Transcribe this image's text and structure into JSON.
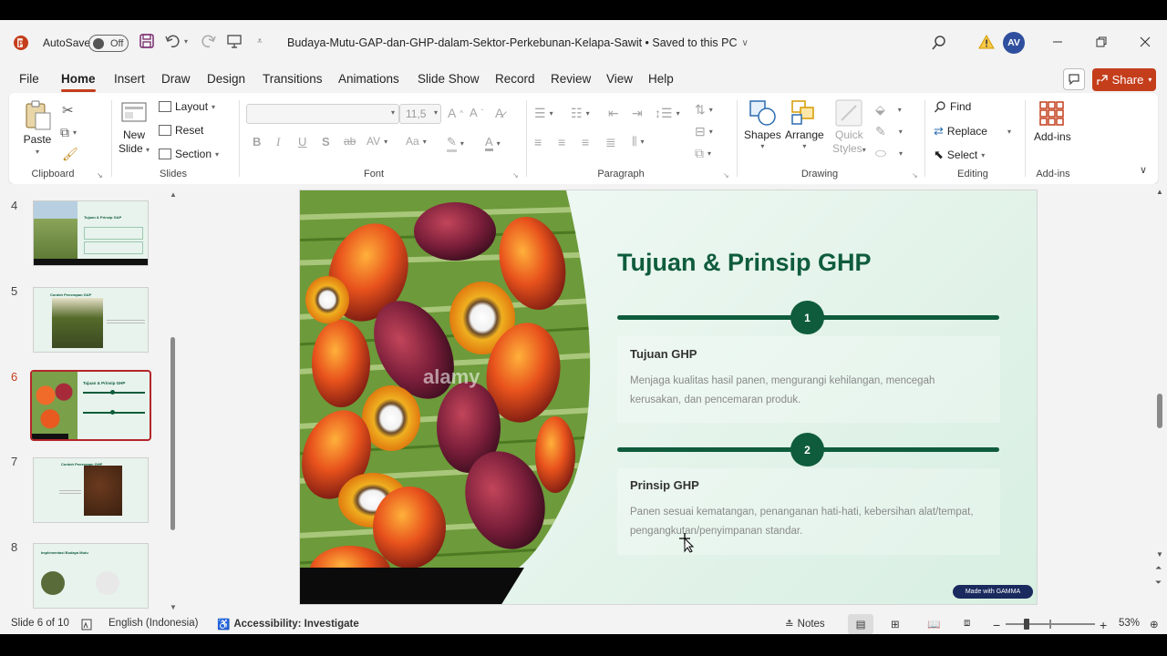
{
  "titlebar": {
    "autosave_label": "AutoSave",
    "toggle_state": "Off",
    "doc_title": "Budaya-Mutu-GAP-dan-GHP-dalam-Sektor-Perkebunan-Kelapa-Sawit • Saved to this PC",
    "avatar_initials": "AV"
  },
  "menu": {
    "items": [
      "File",
      "Home",
      "Insert",
      "Draw",
      "Design",
      "Transitions",
      "Animations",
      "Slide Show",
      "Record",
      "Review",
      "View",
      "Help"
    ],
    "active": "Home",
    "share_label": "Share"
  },
  "ribbon": {
    "clipboard": {
      "paste": "Paste",
      "label": "Clipboard"
    },
    "slides": {
      "new_slide_1": "New",
      "new_slide_2": "Slide",
      "layout": "Layout",
      "reset": "Reset",
      "section": "Section",
      "label": "Slides"
    },
    "font": {
      "size": "11,5",
      "label": "Font"
    },
    "paragraph": {
      "label": "Paragraph"
    },
    "drawing": {
      "shapes": "Shapes",
      "arrange": "Arrange",
      "quick_styles_1": "Quick",
      "quick_styles_2": "Styles",
      "label": "Drawing"
    },
    "editing": {
      "find": "Find",
      "replace": "Replace",
      "select": "Select",
      "label": "Editing"
    },
    "addins": {
      "addins": "Add-ins",
      "label": "Add-ins"
    }
  },
  "thumbnails": [
    {
      "num": "4",
      "title": "Tujuan & Prinsip GAP"
    },
    {
      "num": "5",
      "title": "Contoh Penerapan GAP"
    },
    {
      "num": "6",
      "title": "Tujuan & Prinsip GHP"
    },
    {
      "num": "7",
      "title": "Contoh Penerapan GHP"
    },
    {
      "num": "8",
      "title": "Implementasi Budaya Mutu"
    }
  ],
  "slide": {
    "title": "Tujuan & Prinsip GHP",
    "sections": [
      {
        "num": "1",
        "heading": "Tujuan GHP",
        "body": "Menjaga kualitas hasil panen, mengurangi kehilangan, mencegah kerusakan, dan pencemaran produk."
      },
      {
        "num": "2",
        "heading": "Prinsip GHP",
        "body": "Panen sesuai kematangan, penanganan hati-hati, kebersihan alat/tempat, pengangkutan/penyimpanan standar."
      }
    ],
    "badge": "Made with GAMMA",
    "watermark": "alamy"
  },
  "status": {
    "slide_of": "Slide 6 of 10",
    "language": "English (Indonesia)",
    "accessibility": "Accessibility: Investigate",
    "notes": "Notes",
    "zoom": "53%"
  },
  "colors": {
    "accent": "#c43e1c",
    "slide_green": "#0f5c3c",
    "share_bg": "#c43e1c",
    "selected_thumb": "#b4262a"
  }
}
